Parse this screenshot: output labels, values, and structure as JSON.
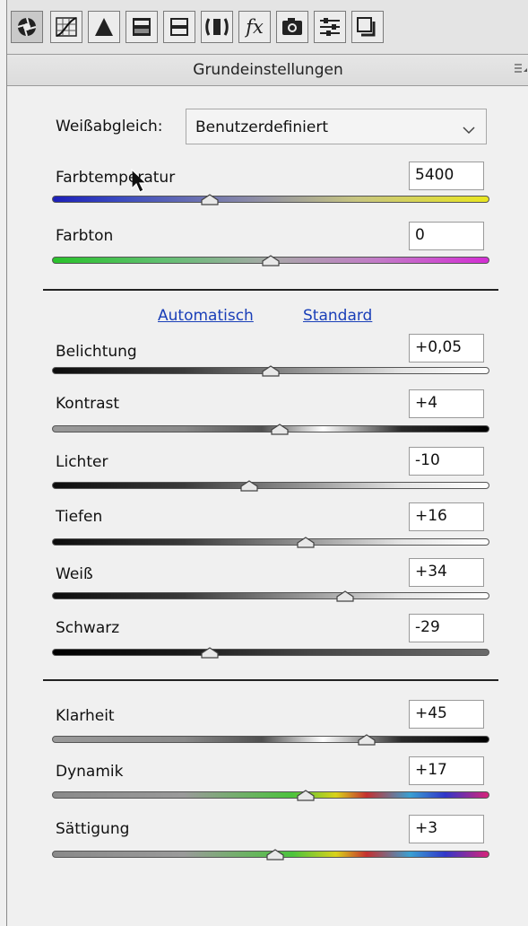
{
  "toolbar": {
    "tools": [
      {
        "name": "basic-tab-icon"
      },
      {
        "name": "tone-curve-tab-icon"
      },
      {
        "name": "detail-tab-icon"
      },
      {
        "name": "hsl-tab-icon"
      },
      {
        "name": "split-toning-tab-icon"
      },
      {
        "name": "lens-corrections-tab-icon"
      },
      {
        "name": "effects-tab-icon"
      },
      {
        "name": "camera-calibration-tab-icon"
      },
      {
        "name": "presets-tab-icon"
      },
      {
        "name": "snapshots-tab-icon"
      }
    ],
    "fx_glyph": "fx"
  },
  "panel": {
    "title": "Grundeinstellungen"
  },
  "white_balance": {
    "label": "Weißabgleich:",
    "value": "Benutzerdefiniert"
  },
  "sliders": [
    {
      "label": "Farbtemperatur",
      "value": "5400",
      "position": 0.36,
      "track": "temperature"
    },
    {
      "label": "Farbton",
      "value": "0",
      "position": 0.5,
      "track": "tint"
    },
    {
      "label": "Belichtung",
      "value": "+0,05",
      "position": 0.5,
      "track": "dark-to-light"
    },
    {
      "label": "Kontrast",
      "value": "+4",
      "position": 0.52,
      "track": "contrast"
    },
    {
      "label": "Lichter",
      "value": "-10",
      "position": 0.45,
      "track": "dark-to-light"
    },
    {
      "label": "Tiefen",
      "value": "+16",
      "position": 0.58,
      "track": "dark-to-light"
    },
    {
      "label": "Weiß",
      "value": "+34",
      "position": 0.67,
      "track": "dark-to-light"
    },
    {
      "label": "Schwarz",
      "value": "-29",
      "position": 0.36,
      "track": "black"
    },
    {
      "label": "Klarheit",
      "value": "+45",
      "position": 0.72,
      "track": "contrast"
    },
    {
      "label": "Dynamik",
      "value": "+17",
      "position": 0.58,
      "track": "saturation"
    },
    {
      "label": "Sättigung",
      "value": "+3",
      "position": 0.51,
      "track": "saturation"
    }
  ],
  "links": {
    "auto": "Automatisch",
    "default": "Standard"
  },
  "colors": {
    "link": "#1a3fb8",
    "panel_bg": "#f0f0f0"
  }
}
